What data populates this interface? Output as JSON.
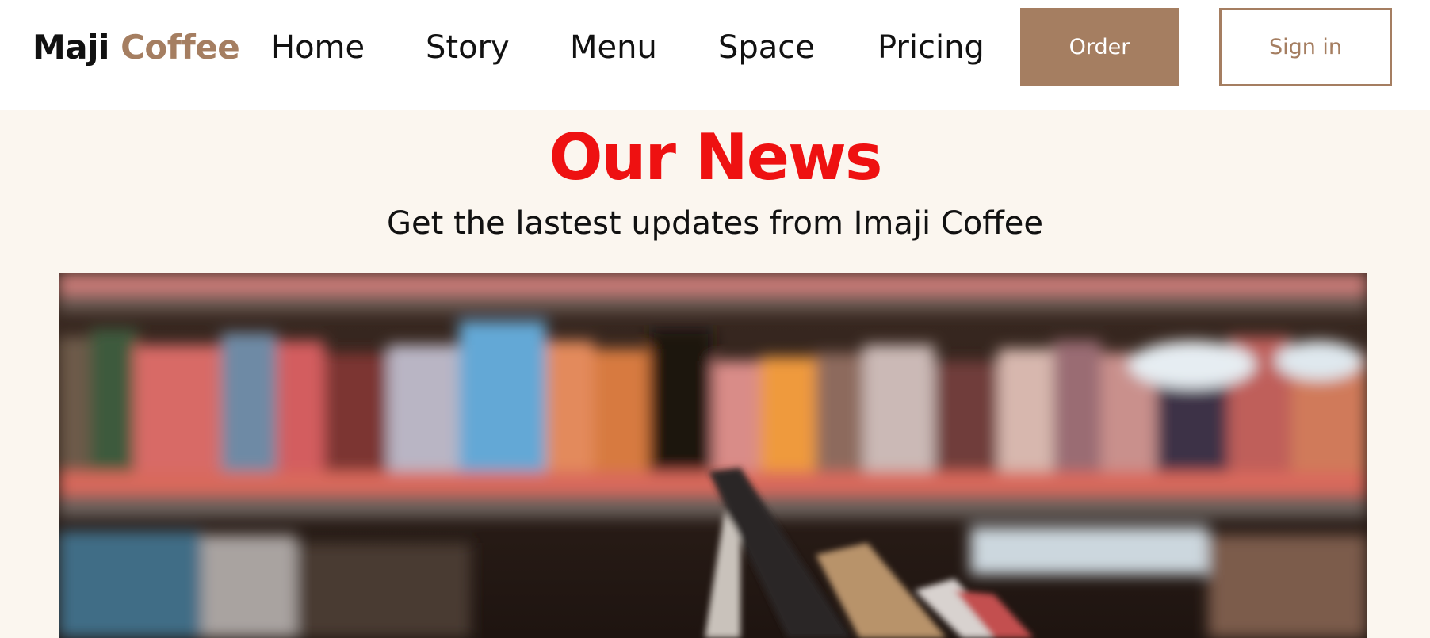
{
  "brand": {
    "name_part1": "Maji",
    "name_part2": "Coffee",
    "accent_color": "#a57e61"
  },
  "nav": {
    "links": [
      {
        "label": "Home"
      },
      {
        "label": "Story"
      },
      {
        "label": "Menu"
      },
      {
        "label": "Space"
      },
      {
        "label": "Pricing"
      }
    ],
    "order_label": "Order",
    "signin_label": "Sign in"
  },
  "hero": {
    "title": "Our News",
    "title_color": "#ee1111",
    "subtitle": "Get the lastest updates from Imaji Coffee",
    "background_color": "#fbf6ef"
  },
  "image": {
    "subject": "blurred bookshelf with books stacked on a table"
  }
}
